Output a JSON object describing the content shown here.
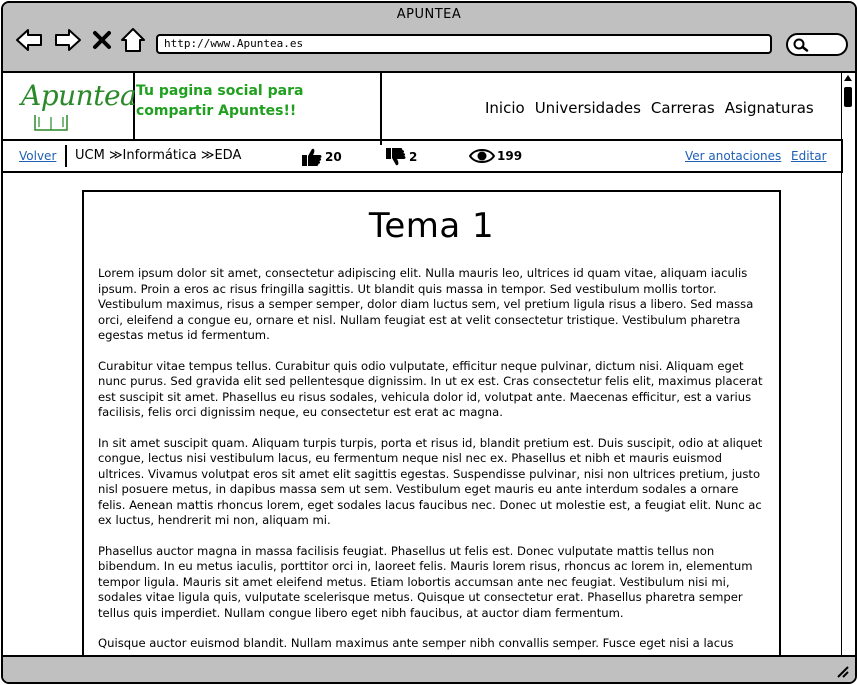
{
  "window": {
    "title": "APUNTEA"
  },
  "browser": {
    "url": "http://www.Apuntea.es",
    "icons": [
      "back-arrow-icon",
      "forward-arrow-icon",
      "close-x-icon",
      "home-icon",
      "search-icon"
    ]
  },
  "site": {
    "logo": "Apuntea",
    "tagline": "Tu pagina social para compartir Apuntes!!",
    "nav": [
      "Inicio",
      "Universidades",
      "Carreras",
      "Asignaturas"
    ]
  },
  "toolbar": {
    "back_label": "Volver",
    "breadcrumb": "UCM ≫Informática ≫EDA",
    "likes": "20",
    "dislikes": "2",
    "views": "199",
    "view_notes_label": "Ver anotaciones",
    "edit_label": "Editar"
  },
  "document": {
    "title": "Tema 1",
    "paragraphs": [
      "Lorem ipsum dolor sit amet, consectetur adipiscing elit. Nulla mauris leo, ultrices id quam vitae, aliquam iaculis ipsum. Proin a eros ac risus fringilla sagittis. Ut blandit quis massa in tempor. Sed vestibulum mollis tortor. Vestibulum maximus, risus a semper semper, dolor diam luctus sem, vel pretium ligula risus a libero. Sed massa orci, eleifend a congue eu, ornare et nisl. Nullam feugiat est at velit consectetur tristique. Vestibulum pharetra egestas metus id fermentum.",
      "Curabitur vitae tempus tellus. Curabitur quis odio vulputate, efficitur neque pulvinar, dictum nisi. Aliquam eget nunc purus. Sed gravida elit sed pellentesque dignissim. In ut ex est. Cras consectetur felis elit, maximus placerat est suscipit sit amet. Phasellus eu risus sodales, vehicula dolor id, volutpat ante. Maecenas efficitur, est a varius facilisis, felis orci dignissim neque, eu consectetur est erat ac magna.",
      "In sit amet suscipit quam. Aliquam turpis turpis, porta et risus id, blandit pretium est. Duis suscipit, odio at aliquet congue, lectus nisi vestibulum lacus, eu fermentum neque nisl nec ex. Phasellus et nibh et mauris euismod ultrices. Vivamus volutpat eros sit amet elit sagittis egestas. Suspendisse pulvinar, nisi non ultrices pretium, justo nisl posuere metus, in dapibus massa sem ut sem. Vestibulum eget mauris eu ante interdum sodales a ornare felis. Aenean mattis rhoncus lorem, eget sodales lacus faucibus nec. Donec ut molestie est, a feugiat elit. Nunc ac ex luctus, hendrerit mi non, aliquam mi.",
      "Phasellus auctor magna in massa facilisis feugiat. Phasellus ut felis est. Donec vulputate mattis tellus non bibendum. In eu metus iaculis, porttitor orci in, laoreet felis. Mauris lorem risus, rhoncus ac lorem in, elementum tempor ligula. Mauris sit amet eleifend metus. Etiam lobortis accumsan ante nec feugiat. Vestibulum nisi mi, sodales vitae ligula quis, vulputate scelerisque metus. Quisque ut consectetur erat. Phasellus pharetra semper tellus quis imperdiet. Nullam congue libero eget nibh faucibus, at auctor diam fermentum.",
      "Quisque auctor euismod blandit. Nullam maximus ante semper nibh convallis semper. Fusce eget nisi a lacus"
    ]
  },
  "colors": {
    "accent_green": "#1fa01f",
    "link_blue": "#1f5fb4",
    "chrome_gray": "#c0c0c0"
  }
}
